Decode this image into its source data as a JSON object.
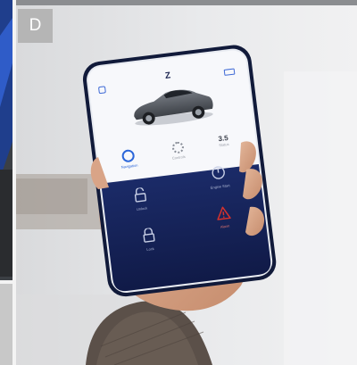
{
  "panel": {
    "label": "D"
  },
  "app": {
    "header_logo": "Z",
    "menu_icon": "grid-icon",
    "battery_icon": "battery-icon",
    "car": "car-image",
    "tabs": [
      {
        "icon": "compass-icon",
        "label": "Navigation"
      },
      {
        "icon": "gear-icon",
        "label": "Controls"
      },
      {
        "icon": "gauge-icon",
        "label": "3.5",
        "sub": "Status"
      }
    ],
    "actions": [
      {
        "icon": "unlock-icon",
        "label": "Unlock"
      },
      {
        "icon": "power-icon",
        "label": "Engine Start"
      },
      {
        "icon": "lock-icon",
        "label": "Lock"
      },
      {
        "icon": "warning-icon",
        "label": "Alarm"
      }
    ]
  },
  "colors": {
    "phone_dark": "#0f1736",
    "panel_navy": "#16255c",
    "accent_blue": "#2b66d9",
    "alarm_red": "#d6322d",
    "car_gray": "#5b5f66"
  }
}
